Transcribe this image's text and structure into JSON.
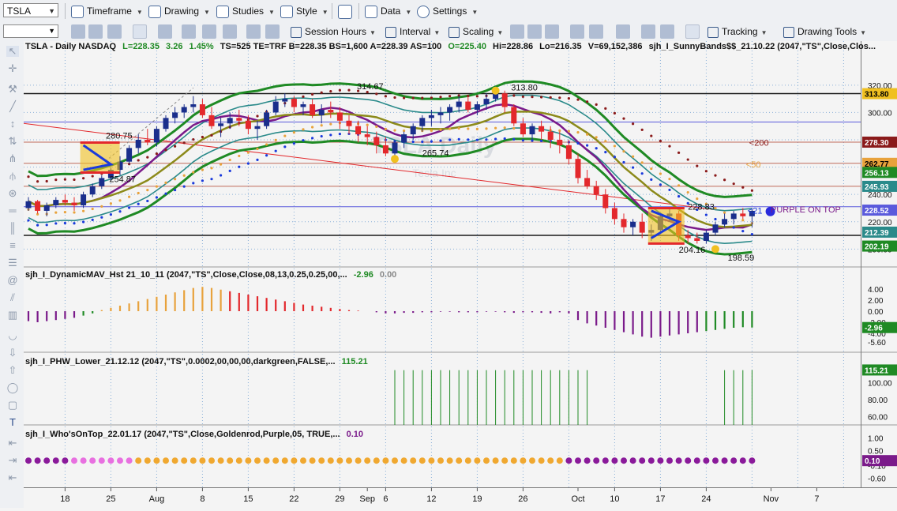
{
  "toolbar": {
    "symbol": "TSLA",
    "menus": [
      "Timeframe",
      "Drawing",
      "Studies",
      "Style",
      "Data",
      "Settings"
    ],
    "menus2": [
      "Session Hours",
      "Interval",
      "Scaling",
      "Tracking",
      "Drawing Tools"
    ]
  },
  "header": {
    "symbol": "TSLA - Daily  NASDAQ",
    "last": "L=228.35",
    "chg": "3.26",
    "pct": "1.45%",
    "rest": "TS=525  TE=TRF  B=228.35  BS=1,600  A=228.39  AS=100",
    "open": "O=225.40",
    "hi": "Hi=228.86",
    "lo": "Lo=216.35",
    "vol": "V=69,152,386",
    "study": "sjh_I_SunnyBands$$_21.10.22 (2047,\"TS\",Close,Clos..."
  },
  "watermark": {
    "title": "TSLA Daily",
    "subtitle": "Tesla Inc"
  },
  "colors": {
    "up": "#1a2e8c",
    "down": "#e3282c",
    "orange": "#e8a23c",
    "green": "#1f8a24",
    "purple": "#7a1a8a",
    "olive": "#8c8a1a",
    "teal": "#2a8a8a",
    "blue": "#1a3adc",
    "darkred": "#8a1a1a",
    "hline": "#1a1a1a",
    "bluehline": "#5a5adc"
  },
  "chart_data": [
    {
      "type": "candlestick",
      "title": "TSLA - Daily  NASDAQ",
      "ylim": [
        195,
        328
      ],
      "price_ticks": [
        "320.00",
        "300.00",
        "280.00",
        "260.00",
        "240.00",
        "220.00",
        "200.00"
      ],
      "x_tick_labels": [
        "18",
        "25",
        "Aug",
        "8",
        "15",
        "22",
        "29",
        "Sep",
        "6",
        "12",
        "19",
        "26",
        "Oct",
        "10",
        "17",
        "24",
        "Nov",
        "7"
      ],
      "axis_tags": [
        {
          "label": "313.80",
          "value": 313.8,
          "color": "#f0c020"
        },
        {
          "label": "278.30",
          "value": 278.3,
          "color": "#8a1a1a"
        },
        {
          "label": "262.77",
          "value": 262.77,
          "color": "#e8a23c"
        },
        {
          "label": "256.13",
          "value": 256.13,
          "color": "#1f8a24"
        },
        {
          "label": "245.93",
          "value": 245.93,
          "color": "#2a8a8a"
        },
        {
          "label": "228.52",
          "value": 228.52,
          "color": "#5a5adc"
        },
        {
          "label": "212.39",
          "value": 212.39,
          "color": "#2a8a8a"
        },
        {
          "label": "202.19",
          "value": 202.19,
          "color": "#1f8a24"
        }
      ],
      "annotations": [
        {
          "text": "314.67",
          "value": 314.67
        },
        {
          "text": "313.80",
          "value": 313.8
        },
        {
          "text": "280.75",
          "value": 280.75
        },
        {
          "text": "254.87",
          "value": 254.87
        },
        {
          "text": "265.74",
          "value": 265.74
        },
        {
          "text": "228.83",
          "value": 228.83
        },
        {
          "text": "204.16",
          "value": 204.16
        },
        {
          "text": "198.59",
          "value": 198.59
        },
        {
          "text": "<200",
          "value": 278
        },
        {
          "text": "<50",
          "value": 262
        },
        {
          "text": "<21",
          "value": 227
        },
        {
          "text": "PURPLE ON TOP",
          "value": 228
        }
      ],
      "candles": [
        [
          230,
          238,
          228,
          235
        ],
        [
          235,
          236,
          226,
          228
        ],
        [
          228,
          234,
          224,
          232
        ],
        [
          232,
          238,
          230,
          236
        ],
        [
          236,
          240,
          232,
          234
        ],
        [
          234,
          238,
          228,
          232
        ],
        [
          232,
          242,
          230,
          240
        ],
        [
          240,
          248,
          238,
          246
        ],
        [
          246,
          254,
          244,
          252
        ],
        [
          252,
          260,
          250,
          258
        ],
        [
          258,
          268,
          254,
          264
        ],
        [
          264,
          276,
          262,
          274
        ],
        [
          274,
          284,
          270,
          280
        ],
        [
          280,
          288,
          276,
          278
        ],
        [
          278,
          290,
          275,
          288
        ],
        [
          288,
          298,
          286,
          296
        ],
        [
          296,
          304,
          292,
          300
        ],
        [
          300,
          306,
          296,
          304
        ],
        [
          304,
          312,
          300,
          306
        ],
        [
          306,
          310,
          296,
          298
        ],
        [
          298,
          304,
          288,
          290
        ],
        [
          290,
          296,
          282,
          292
        ],
        [
          292,
          300,
          288,
          296
        ],
        [
          296,
          302,
          290,
          294
        ],
        [
          294,
          298,
          284,
          288
        ],
        [
          288,
          294,
          280,
          290
        ],
        [
          290,
          302,
          288,
          300
        ],
        [
          300,
          312,
          298,
          308
        ],
        [
          308,
          314,
          304,
          310
        ],
        [
          310,
          312,
          300,
          304
        ],
        [
          304,
          308,
          298,
          306
        ],
        [
          306,
          310,
          296,
          298
        ],
        [
          298,
          306,
          292,
          302
        ],
        [
          302,
          308,
          296,
          300
        ],
        [
          300,
          304,
          288,
          294
        ],
        [
          294,
          298,
          284,
          290
        ],
        [
          290,
          294,
          278,
          284
        ],
        [
          284,
          290,
          276,
          282
        ],
        [
          282,
          286,
          270,
          276
        ],
        [
          276,
          282,
          268,
          270
        ],
        [
          270,
          280,
          266,
          278
        ],
        [
          278,
          286,
          274,
          284
        ],
        [
          284,
          292,
          280,
          290
        ],
        [
          290,
          298,
          286,
          296
        ],
        [
          296,
          302,
          290,
          298
        ],
        [
          298,
          304,
          292,
          300
        ],
        [
          300,
          306,
          294,
          304
        ],
        [
          304,
          312,
          300,
          308
        ],
        [
          308,
          312,
          300,
          302
        ],
        [
          302,
          308,
          298,
          306
        ],
        [
          306,
          314,
          302,
          310
        ],
        [
          310,
          318,
          308,
          314
        ],
        [
          314,
          316,
          300,
          304
        ],
        [
          304,
          306,
          290,
          292
        ],
        [
          292,
          296,
          282,
          284
        ],
        [
          284,
          292,
          280,
          290
        ],
        [
          290,
          294,
          280,
          286
        ],
        [
          286,
          290,
          274,
          280
        ],
        [
          280,
          286,
          270,
          276
        ],
        [
          276,
          280,
          262,
          266
        ],
        [
          266,
          270,
          248,
          252
        ],
        [
          252,
          258,
          244,
          246
        ],
        [
          246,
          250,
          236,
          240
        ],
        [
          240,
          244,
          226,
          230
        ],
        [
          230,
          234,
          218,
          222
        ],
        [
          222,
          226,
          212,
          216
        ],
        [
          216,
          222,
          210,
          220
        ],
        [
          220,
          226,
          208,
          212
        ],
        [
          212,
          218,
          206,
          214
        ],
        [
          214,
          226,
          212,
          224
        ],
        [
          224,
          230,
          220,
          226
        ],
        [
          226,
          228,
          206,
          210
        ],
        [
          210,
          214,
          204,
          208
        ],
        [
          208,
          212,
          204,
          206
        ],
        [
          206,
          214,
          204,
          212
        ],
        [
          212,
          220,
          210,
          218
        ],
        [
          218,
          226,
          216,
          222
        ],
        [
          222,
          228,
          218,
          226
        ],
        [
          226,
          230,
          222,
          224
        ],
        [
          224,
          230,
          216,
          228
        ]
      ]
    },
    {
      "type": "bar",
      "title": "sjh_I_DynamicMAV_Hst 21_10_11 (2047,\"TS\",Close,Close,08,13,0.25,0.25,00,...",
      "current_value": "-2.96",
      "extra_value": "0.00",
      "ylim": [
        -6,
        6
      ],
      "y_tick_labels": [
        "4.00",
        "2.00",
        "0.00",
        "-2.00",
        "-4.00",
        "-5.60"
      ],
      "axis_tags": [
        {
          "label": "-2.96",
          "value": -2.96,
          "color": "#1f8a24"
        }
      ],
      "values": [
        -1.8,
        -2.0,
        -1.8,
        -1.6,
        -1.4,
        -1.2,
        -0.8,
        -0.4,
        0.2,
        0.6,
        1.0,
        1.4,
        1.8,
        2.2,
        2.6,
        3.0,
        3.4,
        3.8,
        4.2,
        4.4,
        4.2,
        3.9,
        3.6,
        3.3,
        3.0,
        2.7,
        2.4,
        2.1,
        1.8,
        1.5,
        1.2,
        1.0,
        0.8,
        0.6,
        0.4,
        0.2,
        0.1,
        0.0,
        -0.2,
        -0.4,
        -0.4,
        -0.3,
        -0.3,
        -0.2,
        -0.2,
        -0.1,
        -0.1,
        -0.2,
        -0.2,
        -0.2,
        -0.1,
        -0.1,
        -0.2,
        -0.3,
        -0.2,
        -0.2,
        -0.3,
        -0.4,
        -0.2,
        -0.4,
        -1.6,
        -2.2,
        -2.6,
        -3.0,
        -3.4,
        -3.8,
        -4.2,
        -4.6,
        -4.8,
        -4.6,
        -4.4,
        -4.2,
        -4.0,
        -3.8,
        -3.6,
        -3.4,
        -3.2,
        -3.0,
        -2.9,
        -2.96
      ]
    },
    {
      "type": "bar",
      "title": "sjh_I_PHW_Lower_21.12.12 (2047,\"TS\",0.0002,00,00,00,darkgreen,FALSE,...",
      "current_value": "115.21",
      "ylim": [
        50,
        125
      ],
      "y_tick_labels": [
        "100.00",
        "80.00",
        "60.00"
      ],
      "axis_tags": [
        {
          "label": "115.21",
          "value": 115.21,
          "color": "#1f8a24"
        }
      ],
      "values": [
        0,
        0,
        0,
        0,
        0,
        0,
        0,
        0,
        0,
        0,
        0,
        0,
        0,
        0,
        0,
        0,
        0,
        0,
        0,
        0,
        0,
        0,
        0,
        0,
        0,
        0,
        0,
        0,
        0,
        0,
        0,
        0,
        0,
        0,
        0,
        0,
        0,
        0,
        0,
        0,
        115,
        115,
        115,
        115,
        115,
        115,
        115,
        115,
        115,
        115,
        115,
        115,
        115,
        115,
        115,
        115,
        115,
        115,
        115,
        115,
        115,
        115,
        0,
        0,
        0,
        0,
        0,
        0,
        0,
        0,
        0,
        0,
        0,
        0,
        0,
        0,
        115,
        115,
        115,
        115.21
      ]
    },
    {
      "type": "scatter",
      "title": "sjh_I_Who'sOnTop_22.01.17 (2047,\"TS\",Close,Goldenrod,Purple,05, TRUE,...",
      "current_value": "0.10",
      "ylim": [
        -0.8,
        1.2
      ],
      "y_tick_labels": [
        "1.00",
        "0.50",
        "-0.10",
        "-0.60"
      ],
      "axis_tags": [
        {
          "label": "0.10",
          "value": 0.1,
          "color": "#7a1a8a"
        }
      ],
      "dot_colors": [
        "purple",
        "purple",
        "purple",
        "purple",
        "purple",
        "violet",
        "violet",
        "violet",
        "violet",
        "violet",
        "violet",
        "violet",
        "gold",
        "gold",
        "gold",
        "gold",
        "gold",
        "gold",
        "gold",
        "gold",
        "gold",
        "gold",
        "gold",
        "gold",
        "gold",
        "gold",
        "gold",
        "gold",
        "gold",
        "gold",
        "gold",
        "gold",
        "gold",
        "gold",
        "gold",
        "gold",
        "gold",
        "gold",
        "gold",
        "gold",
        "gold",
        "gold",
        "gold",
        "gold",
        "gold",
        "gold",
        "gold",
        "gold",
        "gold",
        "gold",
        "gold",
        "gold",
        "gold",
        "gold",
        "gold",
        "gold",
        "gold",
        "gold",
        "gold",
        "purple",
        "purple",
        "purple",
        "purple",
        "purple",
        "purple",
        "purple",
        "purple",
        "purple",
        "purple",
        "purple",
        "purple",
        "purple",
        "purple",
        "purple",
        "purple",
        "purple",
        "purple",
        "purple",
        "purple",
        "purple"
      ]
    }
  ]
}
